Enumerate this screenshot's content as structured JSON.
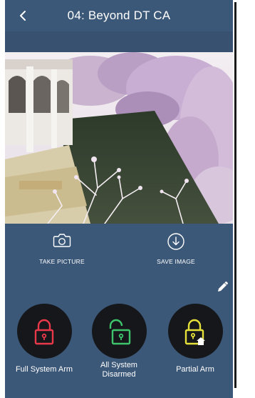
{
  "header": {
    "title": "04: Beyond DT CA"
  },
  "actions": {
    "take_picture": "TAKE PICTURE",
    "save_image": "SAVE IMAGE"
  },
  "arm_modes": {
    "full": {
      "label": "Full System Arm",
      "color": "#e8394a"
    },
    "disarmed": {
      "line1": "All System",
      "line2": "Disarmed",
      "color": "#3ec56b"
    },
    "partial": {
      "label": "Partial Arm",
      "color": "#e6e13a"
    }
  },
  "colors": {
    "background": "#3c5878",
    "subbar": "#385170",
    "circle": "#15171a"
  }
}
